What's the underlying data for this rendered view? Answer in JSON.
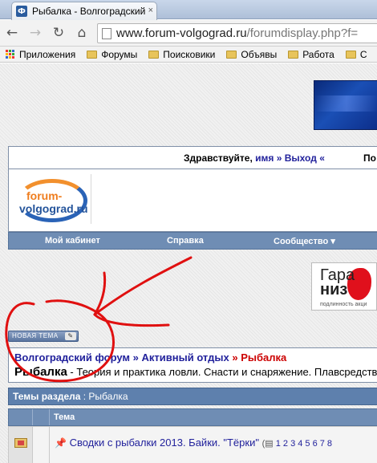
{
  "browser": {
    "tab_title": "Рыбалка - Волгоградский",
    "tab_close": "×",
    "favicon": "Ф",
    "url_host": "www.forum-volgograd.ru",
    "url_rest": "/forumdisplay.php?f=",
    "icons": [
      "back-arrow-icon",
      "forward-arrow-icon",
      "reload-icon",
      "home-icon",
      "page-icon"
    ],
    "bookmarks": [
      "Приложения",
      "Форумы",
      "Поисковики",
      "Объявы",
      "Работа",
      "С"
    ]
  },
  "header": {
    "greeting": "Здравствуйте,",
    "user_name": "имя",
    "sep": "»",
    "logout": "Выход",
    "logout_suffix": "«",
    "right_cut": "По"
  },
  "logo": {
    "line1": "forum-",
    "line2": "volgograd.ru"
  },
  "nav": {
    "items": [
      "Мой кабинет",
      "Справка",
      "Сообщество ▾"
    ]
  },
  "ad": {
    "line1": "Гара",
    "line2": "низ",
    "line3": "подлинность акци"
  },
  "new_topic_button": "НОВАЯ ТЕМА",
  "breadcrumb": {
    "root": "Волгоградский форум",
    "arrow1": " » ",
    "level2": "Активный отдых",
    "arrow2": " » ",
    "current": "Рыбалка"
  },
  "forum": {
    "title": "Рыбалка",
    "subtitle": " - Теория и практика ловли. Снасти и снаряжение. Плавсредства"
  },
  "threads": {
    "header_bold": "Темы раздела",
    "header_rest": " : Рыбалка",
    "col_topic": "Тема",
    "rows": [
      {
        "title": "Сводки с рыбалки 2013. Байки. \"Тёрки\"",
        "pages_prefix": "(",
        "pages": "1 2 3 4 5 6 7 8"
      }
    ]
  },
  "colors": {
    "nav_bg": "#6f8db4",
    "link": "#22229c",
    "current_crumb": "#c00",
    "annotation_red": "#e01010"
  }
}
